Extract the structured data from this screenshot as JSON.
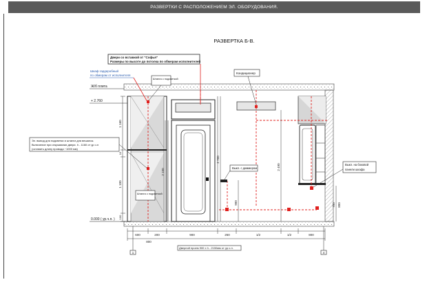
{
  "sheet": {
    "header": "РАЗВЕРТКИ С РАСПОЛОЖЕНИЕМ ЭЛ. ОБОРУДОВАНИЯ.",
    "title": "РАЗВЕРТКА Б-В."
  },
  "notes": {
    "door_line1": "Двери со вставкой от \"Софья\"",
    "door_line2": "Размеры по высоте до потолка по обмерам исполнителей",
    "wardrobe_line1": "Шкаф гардеробный",
    "wardrobe_line2": "по обмерам от исполнителя",
    "slab": "Ж/б плита",
    "conditioner": "Кондиционер",
    "led_strip_top": "Штанга с подсветкой",
    "led_strip_bottom": "Штанга с подсветкой",
    "el_outlet_line1": "Эл. вывод для подсветки и штанги для вешалок.",
    "el_outlet_line2": "Включение при открывании двери. h - 1160 от ур.ч.п",
    "el_outlet_line3": "(оставить длину провода ~1000 мм)",
    "dimmer_switch": "Выкл. с диммером",
    "side_switch_line1": "Выкл. на боковой",
    "side_switch_line2": "панели шкафа",
    "door_opening": "Дверной проем 900 х h - 2150мм от ур.ч.п."
  },
  "levels": {
    "top": "+ 2.760",
    "floor": "0.000 ( ур.ч.п. )"
  },
  "dims": {
    "left_vertical": [
      "1 160",
      "10",
      "1 100",
      "100"
    ],
    "door_height": "2 150",
    "door_full": "2 760",
    "right_height": "2 490",
    "switch_height": "900",
    "right_side_a": "750",
    "right_side_b": "800",
    "bottom_row": [
      "600",
      "200",
      "900",
      "250",
      "1/2",
      "1/2",
      "800"
    ],
    "bottom_total": "800"
  },
  "markers": {
    "left": "1",
    "right": "4"
  },
  "colors": {
    "header_bg": "#5a5a5a",
    "line": "#222222",
    "red": "#e0201e",
    "blue": "#2a5db0",
    "hatch": "#b0b0b0"
  }
}
